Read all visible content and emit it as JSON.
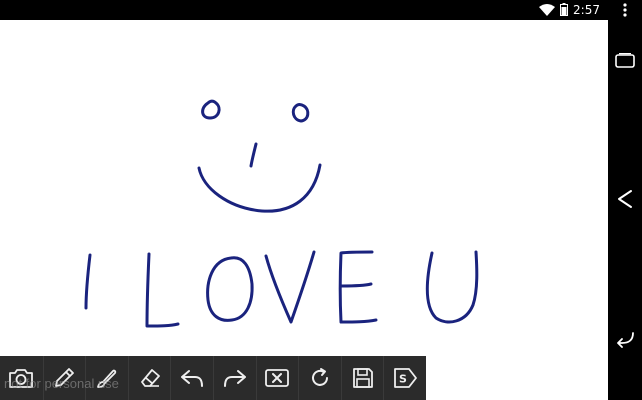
{
  "status_bar": {
    "time": "2:57",
    "icons": [
      "wifi-icon",
      "battery-icon"
    ]
  },
  "drawing": {
    "text": "I LOVE U",
    "ink_color": "#1a237e",
    "background": "#ffffff"
  },
  "toolbar": {
    "tools": [
      {
        "name": "camera-icon"
      },
      {
        "name": "pencil-icon"
      },
      {
        "name": "brush-icon"
      },
      {
        "name": "eraser-icon"
      },
      {
        "name": "undo-icon"
      },
      {
        "name": "redo-icon"
      },
      {
        "name": "clear-icon"
      },
      {
        "name": "refresh-icon"
      },
      {
        "name": "save-icon"
      },
      {
        "name": "share-icon"
      }
    ],
    "background": "#2b2b2b"
  },
  "hint": {
    "text": "not for personal use"
  },
  "nav_bar": {
    "buttons": [
      "recent-apps-icon",
      "home-icon",
      "back-icon"
    ]
  }
}
